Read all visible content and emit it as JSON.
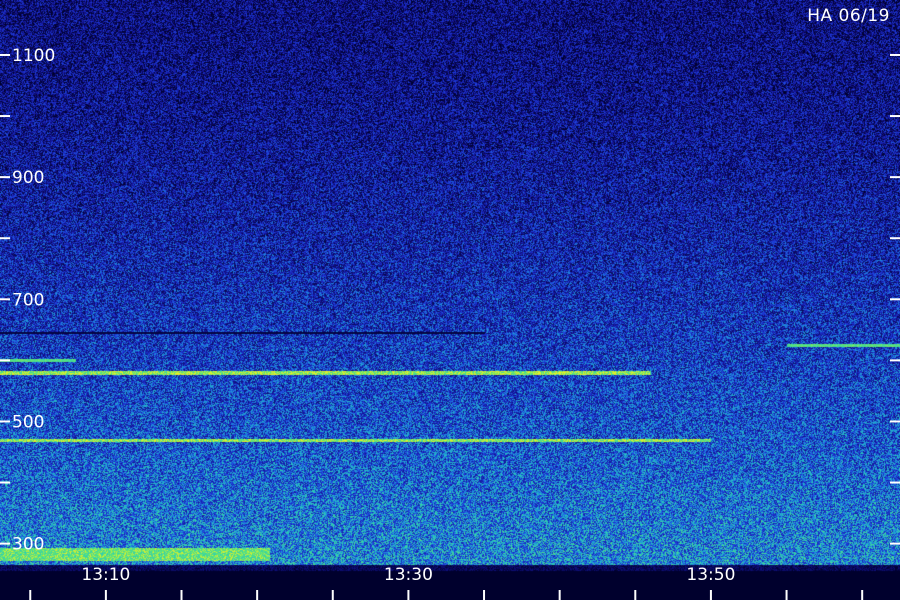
{
  "station_label": "HA 06/19",
  "chart_data": {
    "type": "heatmap",
    "title": "",
    "xlabel": "",
    "ylabel": "",
    "x_tick_labels": [
      "13:10",
      "13:30",
      "13:50"
    ],
    "x_tick_minutes": [
      10,
      30,
      50
    ],
    "xlim_minutes": [
      3,
      62.5
    ],
    "y_tick_labels": [
      "300",
      "500",
      "700",
      "900",
      "1100"
    ],
    "y_tick_values": [
      300,
      500,
      700,
      900,
      1100
    ],
    "ylim": [
      265,
      1190
    ],
    "grid": false,
    "lines": [
      {
        "y": 580,
        "x_end_minutes": 46,
        "strength": 0.9
      },
      {
        "y": 470,
        "x_end_minutes": 50,
        "strength": 0.85
      },
      {
        "y": 600,
        "x_end_minutes": 8,
        "strength": 0.4
      },
      {
        "y": 625,
        "x_start_minutes": 55,
        "strength": 0.4
      }
    ],
    "gap_line": {
      "y": 645,
      "x_end_minutes": 35
    }
  }
}
